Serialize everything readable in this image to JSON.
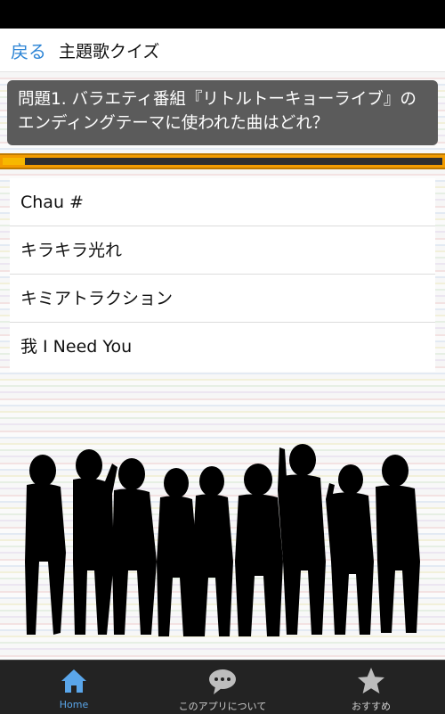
{
  "header": {
    "back_label": "戻る",
    "title": "主題歌クイズ"
  },
  "question": {
    "text": "問題1. バラエティ番組『リトルトーキョーライブ』のエンディングテーマに使われた曲はどれ？",
    "progress_fraction": 0.05
  },
  "answers": [
    "Chau #",
    "キラキラ光れ",
    "キミアトラクション",
    "我 I Need You"
  ],
  "tabs": [
    {
      "label": "Home",
      "icon": "home-icon",
      "active": true
    },
    {
      "label": "このアプリについて",
      "icon": "speech-bubble-icon",
      "active": false
    },
    {
      "label": "おすすめ",
      "icon": "star-icon",
      "active": false
    }
  ],
  "colors": {
    "accent": "#2f86d6",
    "progress_orange": "#f39c00",
    "tab_active": "#5aa6ea"
  }
}
